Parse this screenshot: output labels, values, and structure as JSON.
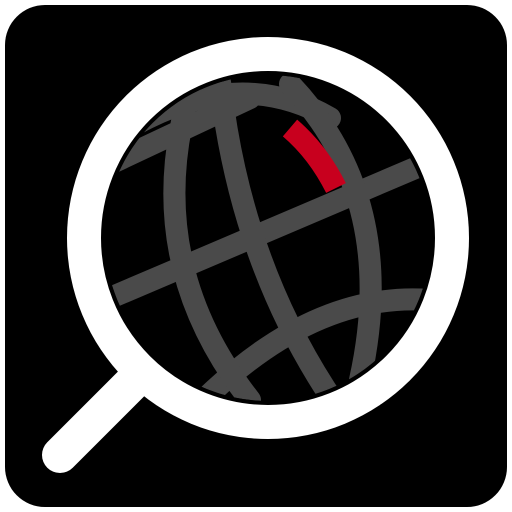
{
  "icon": {
    "name": "globe-search-icon",
    "colors": {
      "background_tile": "#000000",
      "lens_ring_and_handle": "#ffffff",
      "globe_disc": "#000000",
      "grid_lines": "#4a4a4a",
      "highlight_segment": "#c8001e",
      "page_background": "#ffffff"
    }
  }
}
